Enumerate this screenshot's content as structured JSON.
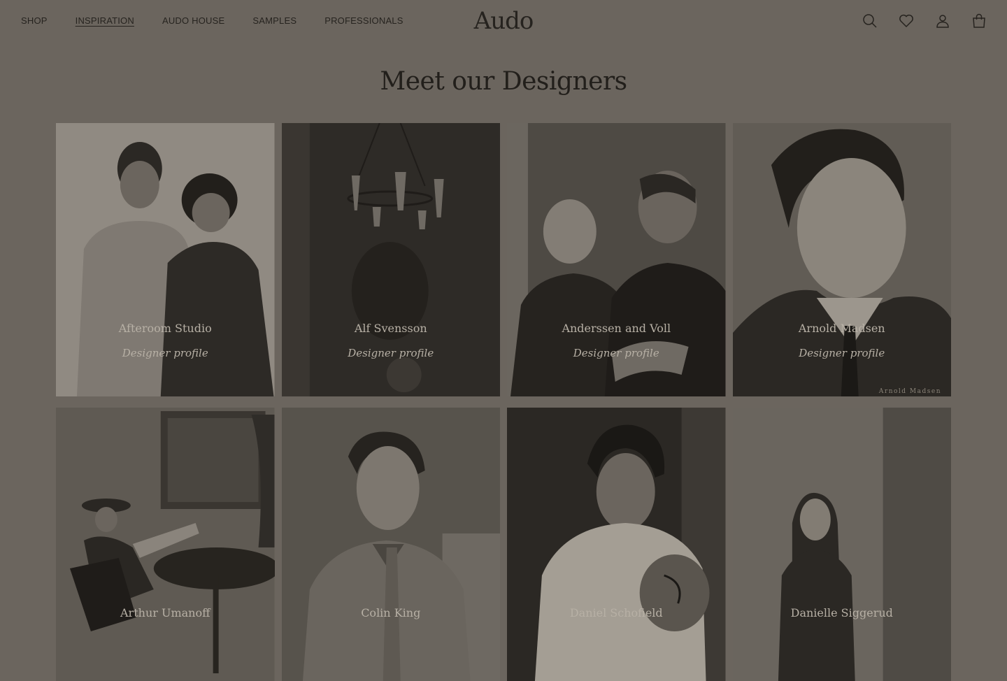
{
  "header": {
    "nav": [
      {
        "label": "SHOP",
        "active": false
      },
      {
        "label": "INSPIRATION",
        "active": true
      },
      {
        "label": "AUDO HOUSE",
        "active": false
      },
      {
        "label": "SAMPLES",
        "active": false
      },
      {
        "label": "PROFESSIONALS",
        "active": false
      }
    ],
    "logo": "Audo",
    "icons": [
      "search-icon",
      "heart-icon",
      "account-icon",
      "bag-icon"
    ]
  },
  "page": {
    "title": "Meet our Designers"
  },
  "designers": [
    {
      "name": "Afteroom Studio",
      "link": "Designer profile"
    },
    {
      "name": "Alf Svensson",
      "link": "Designer profile"
    },
    {
      "name": "Anderssen and Voll",
      "link": "Designer profile"
    },
    {
      "name": "Arnold Madsen",
      "link": "Designer profile",
      "caption": "Arnold Madsen"
    },
    {
      "name": "Arthur Umanoff"
    },
    {
      "name": "Colin King"
    },
    {
      "name": "Daniel Schofield"
    },
    {
      "name": "Danielle Siggerud"
    }
  ],
  "colors": {
    "overlay_background": "#6b655e",
    "text_dark": "#26231f",
    "card_text": "#b7b0a5"
  }
}
